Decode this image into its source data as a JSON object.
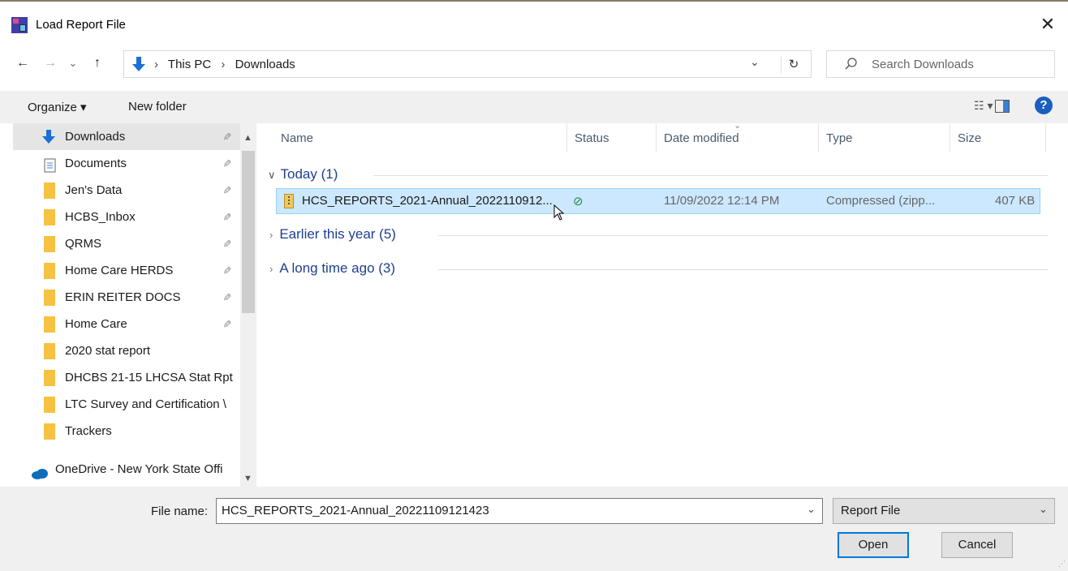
{
  "window": {
    "title": "Load Report File",
    "close_glyph": "✕"
  },
  "nav_buttons": {
    "back": "←",
    "forward": "→",
    "recent": "⌄",
    "up": "↑"
  },
  "address": {
    "crumbs": [
      "This PC",
      "Downloads"
    ],
    "separator": "›",
    "dropdown_glyph": "⌄",
    "refresh_glyph": "↻"
  },
  "search": {
    "placeholder": "Search Downloads",
    "icon": "search-icon"
  },
  "toolbar": {
    "organize": "Organize ▾",
    "new_folder": "New folder",
    "view_glyph": "☷ ▾",
    "help": "?"
  },
  "sidebar": {
    "items": [
      {
        "label": "Downloads",
        "icon": "download-arrow-icon",
        "pinned": true,
        "selected": true
      },
      {
        "label": "Documents",
        "icon": "document-icon",
        "pinned": true
      },
      {
        "label": "Jen's Data",
        "icon": "folder-icon",
        "pinned": true
      },
      {
        "label": "HCBS_Inbox",
        "icon": "folder-icon",
        "pinned": true
      },
      {
        "label": "QRMS",
        "icon": "folder-icon",
        "pinned": true
      },
      {
        "label": "Home Care HERDS",
        "icon": "folder-icon",
        "pinned": true
      },
      {
        "label": "ERIN REITER DOCS",
        "icon": "folder-icon",
        "pinned": true
      },
      {
        "label": "Home Care",
        "icon": "folder-icon",
        "pinned": true
      },
      {
        "label": "2020 stat report",
        "icon": "folder-icon"
      },
      {
        "label": "DHCBS 21-15 LHCSA Stat Rpt",
        "icon": "folder-icon"
      },
      {
        "label": "LTC Survey and Certification \\",
        "icon": "folder-icon"
      },
      {
        "label": "Trackers",
        "icon": "folder-icon"
      },
      {
        "label": "OneDrive - New York State Offi",
        "icon": "cloud-icon"
      }
    ],
    "pin_glyph": "📌"
  },
  "columns": {
    "name": "Name",
    "status": "Status",
    "date": "Date modified",
    "type": "Type",
    "size": "Size"
  },
  "groups": [
    {
      "label": "Today (1)",
      "expanded": true
    },
    {
      "label": "Earlier this year (5)",
      "expanded": false
    },
    {
      "label": "A long time ago (3)",
      "expanded": false
    }
  ],
  "files": [
    {
      "name": "HCS_REPORTS_2021-Annual_2022110912...",
      "status_glyph": "⊘",
      "date": "11/09/2022 12:14 PM",
      "type": "Compressed (zipp...",
      "size": "407 KB"
    }
  ],
  "footer": {
    "file_name_label": "File name:",
    "file_name_value": "HCS_REPORTS_2021-Annual_20221109121423",
    "file_type": "Report File",
    "open": "Open",
    "cancel": "Cancel"
  },
  "colors": {
    "accent": "#0078d7",
    "selection": "#cce8ff",
    "group_text": "#1e3f8f",
    "folder": "#f5c242"
  }
}
